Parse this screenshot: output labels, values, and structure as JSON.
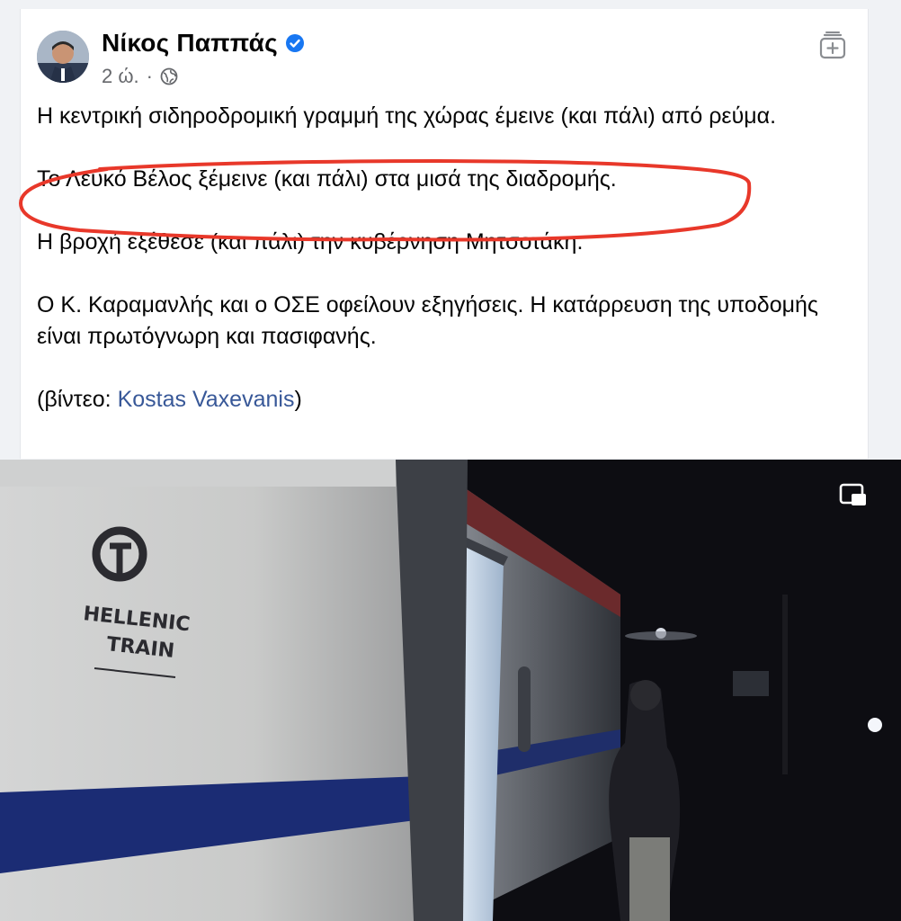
{
  "post": {
    "author": "Νίκος Παππάς",
    "time": "2 ώ.",
    "separator": "·",
    "paragraphs": [
      "Η κεντρική σιδηροδρομική γραμμή της χώρας έμεινε (και πάλι) από ρεύμα.",
      "Το Λευκό Βέλος ξέμεινε (και πάλι) στα μισά της διαδρομής.",
      "Η βροχή εξέθεσε (και πάλι) την κυβέρνηση Μητσοτάκη.",
      "Ο Κ. Καραμανλής και ο ΟΣΕ οφείλουν εξηγήσεις. Η κατάρρευση της υποδομής είναι πρωτόγνωρη και πασιφανής."
    ],
    "credit_prefix": "(βίντεο: ",
    "credit_link": "Kostas Vaxevanis",
    "credit_suffix": ")"
  },
  "video": {
    "logo_line1": "HELLENIC",
    "logo_line2": "TRAIN"
  },
  "icons": {
    "verified": "verified-badge-icon",
    "audience": "globe-icon",
    "save": "save-post-icon",
    "pip": "picture-in-picture-icon"
  },
  "colors": {
    "link": "#385898",
    "verified": "#1877f2",
    "highlight_circle": "#e8382a"
  }
}
